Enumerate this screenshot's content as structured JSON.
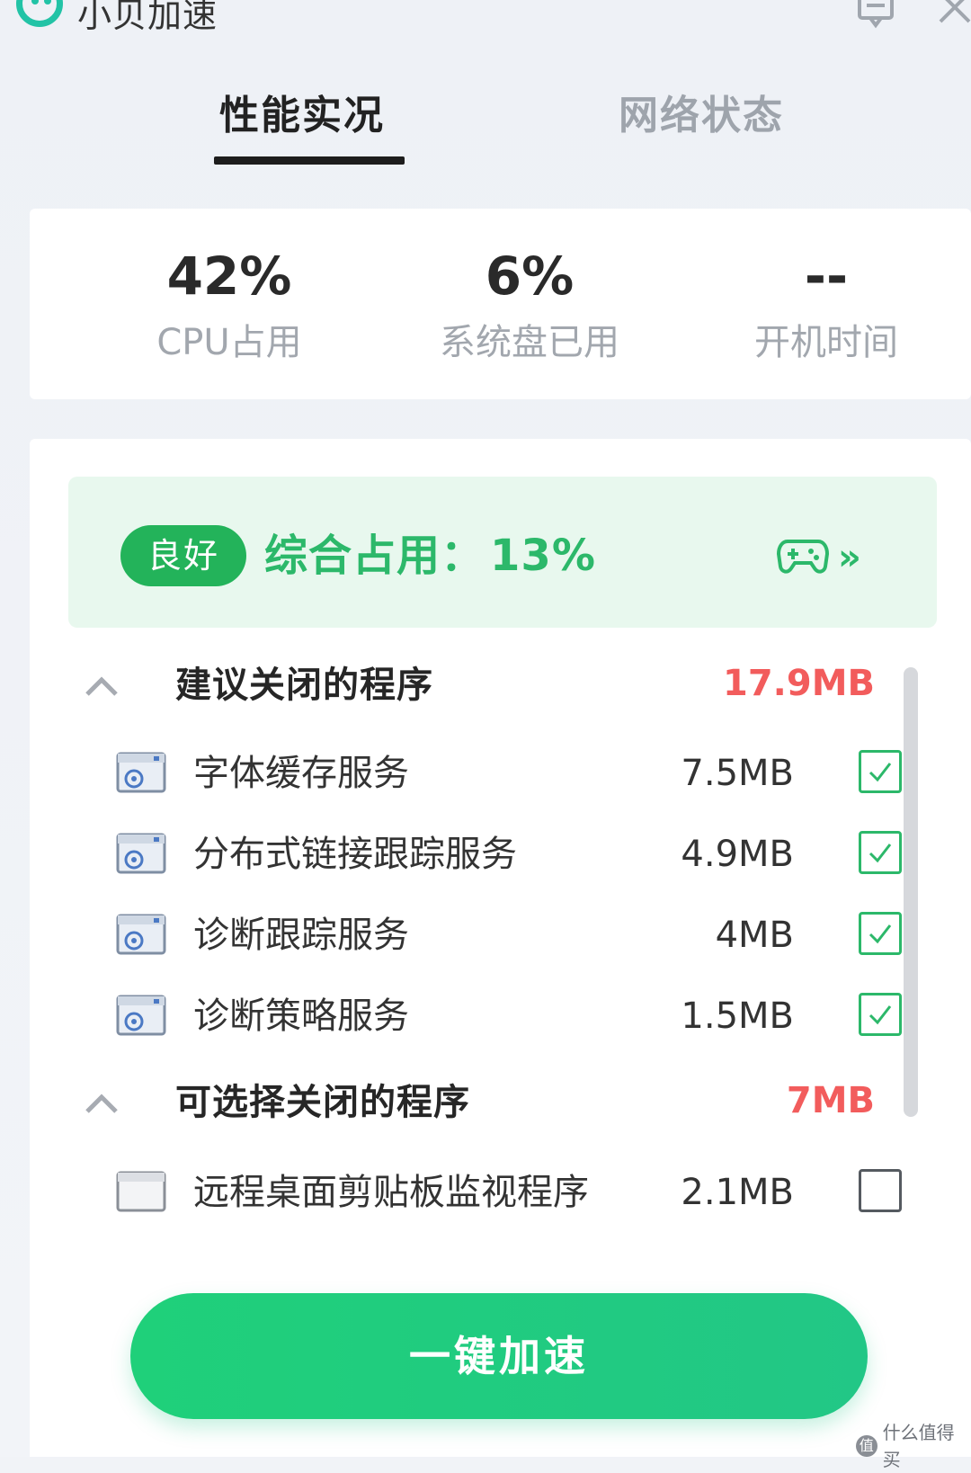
{
  "app": {
    "title": "小贝加速"
  },
  "tabs": [
    {
      "label": "性能实况",
      "active": true
    },
    {
      "label": "网络状态",
      "active": false
    }
  ],
  "stats": [
    {
      "value": "42%",
      "label": "CPU占用"
    },
    {
      "value": "6%",
      "label": "系统盘已用"
    },
    {
      "value": "--",
      "label": "开机时间"
    }
  ],
  "status": {
    "badge": "良好",
    "text": "综合占用：",
    "percent": "13%",
    "more_label": "»"
  },
  "sections": [
    {
      "title": "建议关闭的程序",
      "total": "17.9MB",
      "items": [
        {
          "name": "字体缓存服务",
          "size": "7.5MB",
          "checked": true
        },
        {
          "name": "分布式链接跟踪服务",
          "size": "4.9MB",
          "checked": true
        },
        {
          "name": "诊断跟踪服务",
          "size": "4MB",
          "checked": true
        },
        {
          "name": "诊断策略服务",
          "size": "1.5MB",
          "checked": true
        }
      ]
    },
    {
      "title": "可选择关闭的程序",
      "total": "7MB",
      "items": [
        {
          "name": "远程桌面剪贴板监视程序",
          "size": "2.1MB",
          "checked": false
        }
      ]
    }
  ],
  "actions": {
    "accelerate_label": "一键加速"
  },
  "watermark": {
    "icon_glyph": "值",
    "text": "什么值得买"
  },
  "colors": {
    "accent_green": "#2cb86a",
    "badge_green": "#23b35a",
    "banner_bg": "#e8f8ee",
    "total_red": "#f25c5c",
    "tab_active": "#222222",
    "tab_inactive": "#9ea4ac"
  }
}
